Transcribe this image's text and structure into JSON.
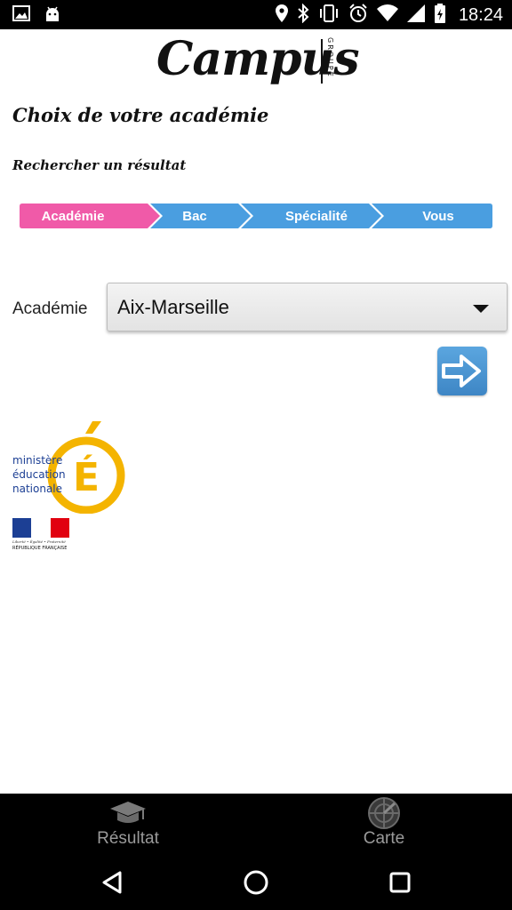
{
  "status_bar": {
    "time": "18:24",
    "left_icons": [
      "image-notification-icon",
      "android-debug-icon"
    ],
    "right_icons": [
      "location-icon",
      "bluetooth-icon",
      "vibrate-icon",
      "alarm-icon",
      "wifi-icon",
      "cell-signal-icon",
      "battery-charging-icon"
    ]
  },
  "header": {
    "logo_text": "Campus",
    "logo_side_text": "GROUPE"
  },
  "page": {
    "title": "Choix de votre académie",
    "subtitle": "Rechercher un résultat"
  },
  "steps": [
    {
      "label": "Académie",
      "active": true
    },
    {
      "label": "Bac",
      "active": false
    },
    {
      "label": "Spécialité",
      "active": false
    },
    {
      "label": "Vous",
      "active": false
    }
  ],
  "colors": {
    "step_active": "#f05aa8",
    "step_inactive": "#4a9ee0",
    "go_button": "#4a93d3",
    "men_yellow": "#f4b400",
    "men_blue": "#1c3f94"
  },
  "form": {
    "academie_label": "Académie",
    "academie_value": "Aix-Marseille"
  },
  "logos": {
    "ministere_lines": [
      "ministère",
      "éducation",
      "nationale"
    ],
    "ministere_letter": "É",
    "rf_motto": "Liberté • Égalité • Fraternité",
    "rf_name": "RÉPUBLIQUE FRANÇAISE"
  },
  "bottom_tabs": [
    {
      "label": "Résultat",
      "icon": "graduation-cap-icon"
    },
    {
      "label": "Carte",
      "icon": "radar-map-icon"
    }
  ],
  "nav_bar": [
    "back-icon",
    "home-icon",
    "recents-icon"
  ]
}
